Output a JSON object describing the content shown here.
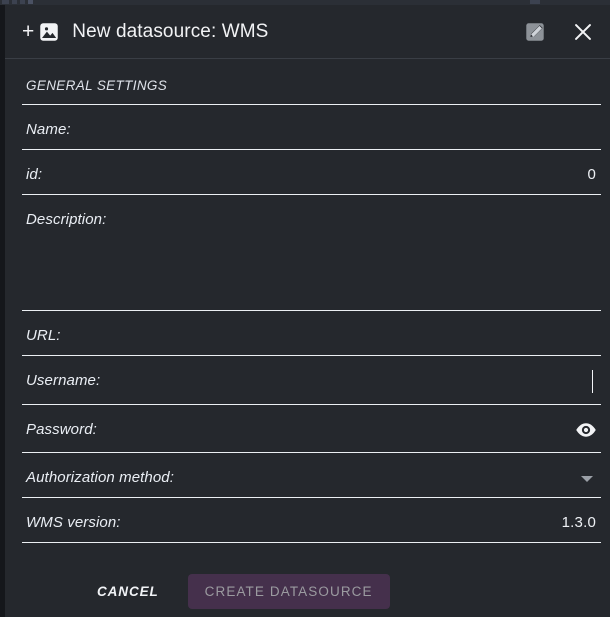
{
  "backdrop": {
    "visible": true
  },
  "titlebar": {
    "add_icon": "plus-icon",
    "source_icon": "image-icon",
    "title": "New datasource: WMS",
    "edit_icon": "edit-square-icon",
    "close_icon": "close-icon"
  },
  "form": {
    "section_title": "GENERAL SETTINGS",
    "fields": [
      {
        "label": "Name:",
        "value": ""
      },
      {
        "label": "id:",
        "value": "0"
      },
      {
        "label": "Description:",
        "value": ""
      },
      {
        "label": "URL:",
        "value": ""
      },
      {
        "label": "Username:",
        "value": ""
      },
      {
        "label": "Password:",
        "value": ""
      },
      {
        "label": "Authorization method:",
        "value": ""
      },
      {
        "label": "WMS version:",
        "value": "1.3.0"
      }
    ],
    "password_visibility_icon": "eye-icon",
    "authorization_dropdown_icon": "chevron-down-icon"
  },
  "footer": {
    "cancel_label": "CANCEL",
    "create_label": "CREATE DATASOURCE",
    "create_enabled": false
  },
  "colors": {
    "dialog_background": "#25282d",
    "backdrop": "#1c1f24",
    "text_primary": "#f2f3f5",
    "label_text": "#eaeef4",
    "divider": "#eceff3",
    "create_button_background": "#45304c",
    "create_button_text": "#9b9ba0"
  }
}
